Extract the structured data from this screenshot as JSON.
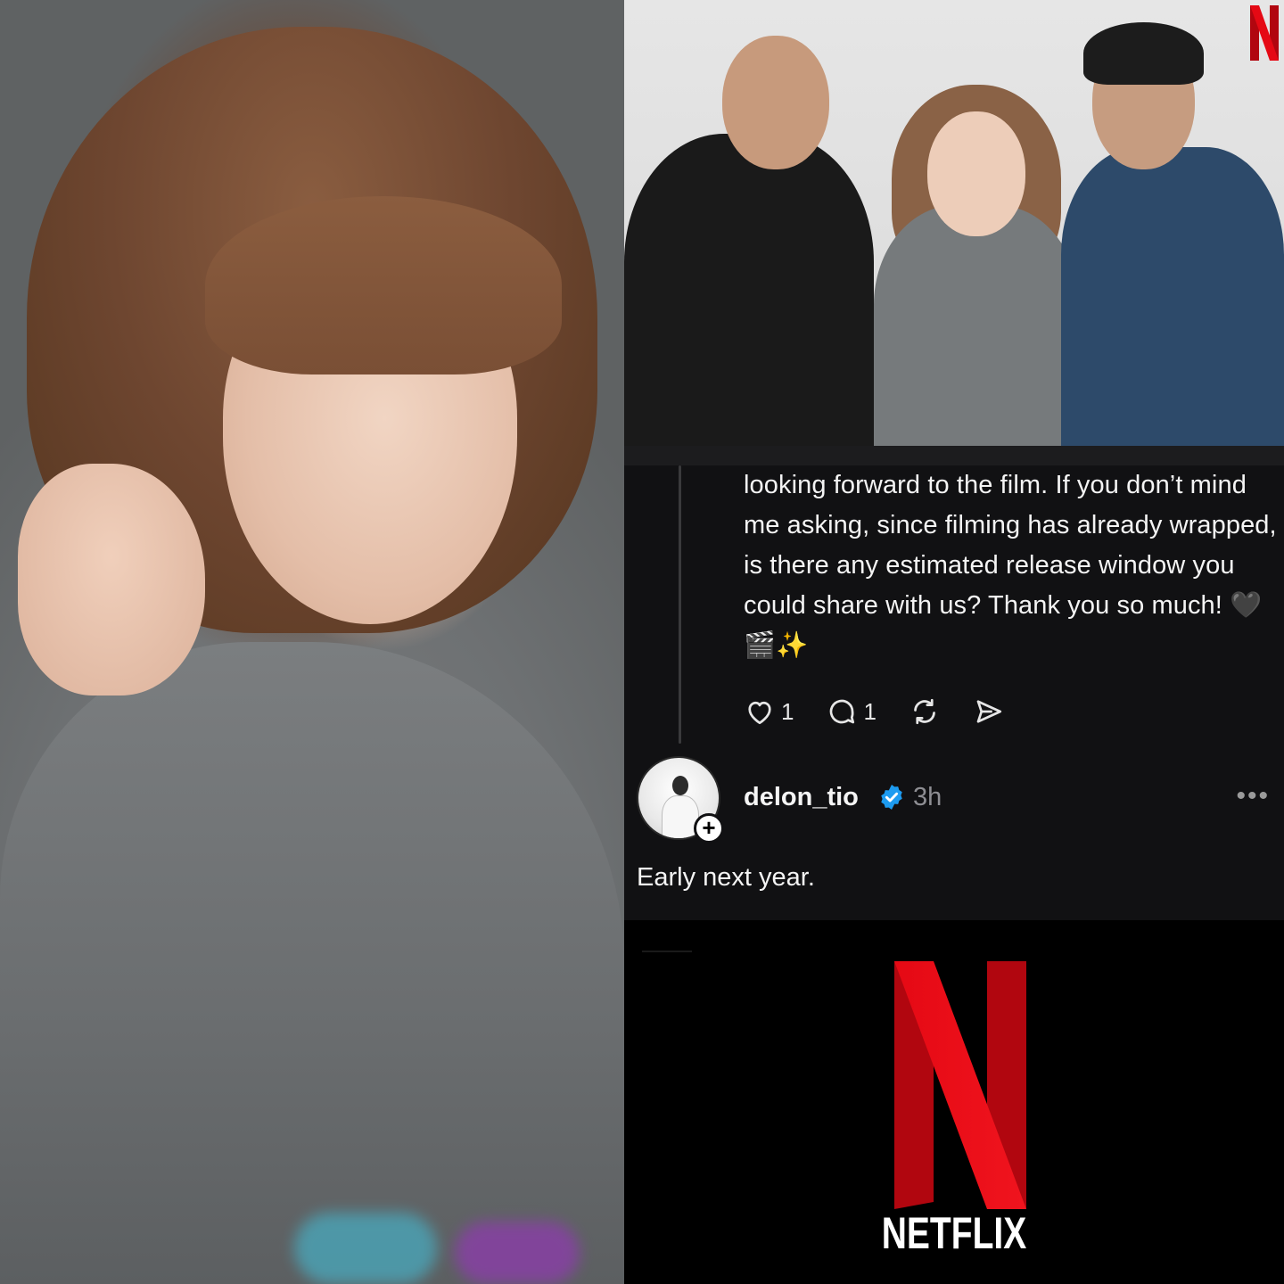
{
  "photos": {
    "left_portrait": "portrait-photo",
    "group_photo": "group-photo"
  },
  "brand": {
    "name": "NETFLIX",
    "red": "#e50914",
    "dark_red": "#b1060f"
  },
  "comment": {
    "text": "looking forward to the film. If you don’t mind me asking, since filming has already wrapped, is there any estimated release window you could share with us? Thank you so much! 🖤🎬✨",
    "like_count": "1",
    "reply_count": "1"
  },
  "reply": {
    "username": "delon_tio",
    "time": "3h",
    "more": "•••",
    "follow_symbol": "+",
    "text": "Early next year."
  },
  "colors": {
    "panel_bg": "#111113",
    "verified_blue": "#1d9bf0",
    "muted_text": "#8e8e93"
  },
  "icons": [
    "heart-icon",
    "comment-icon",
    "repost-icon",
    "share-icon",
    "verified-badge-icon"
  ]
}
